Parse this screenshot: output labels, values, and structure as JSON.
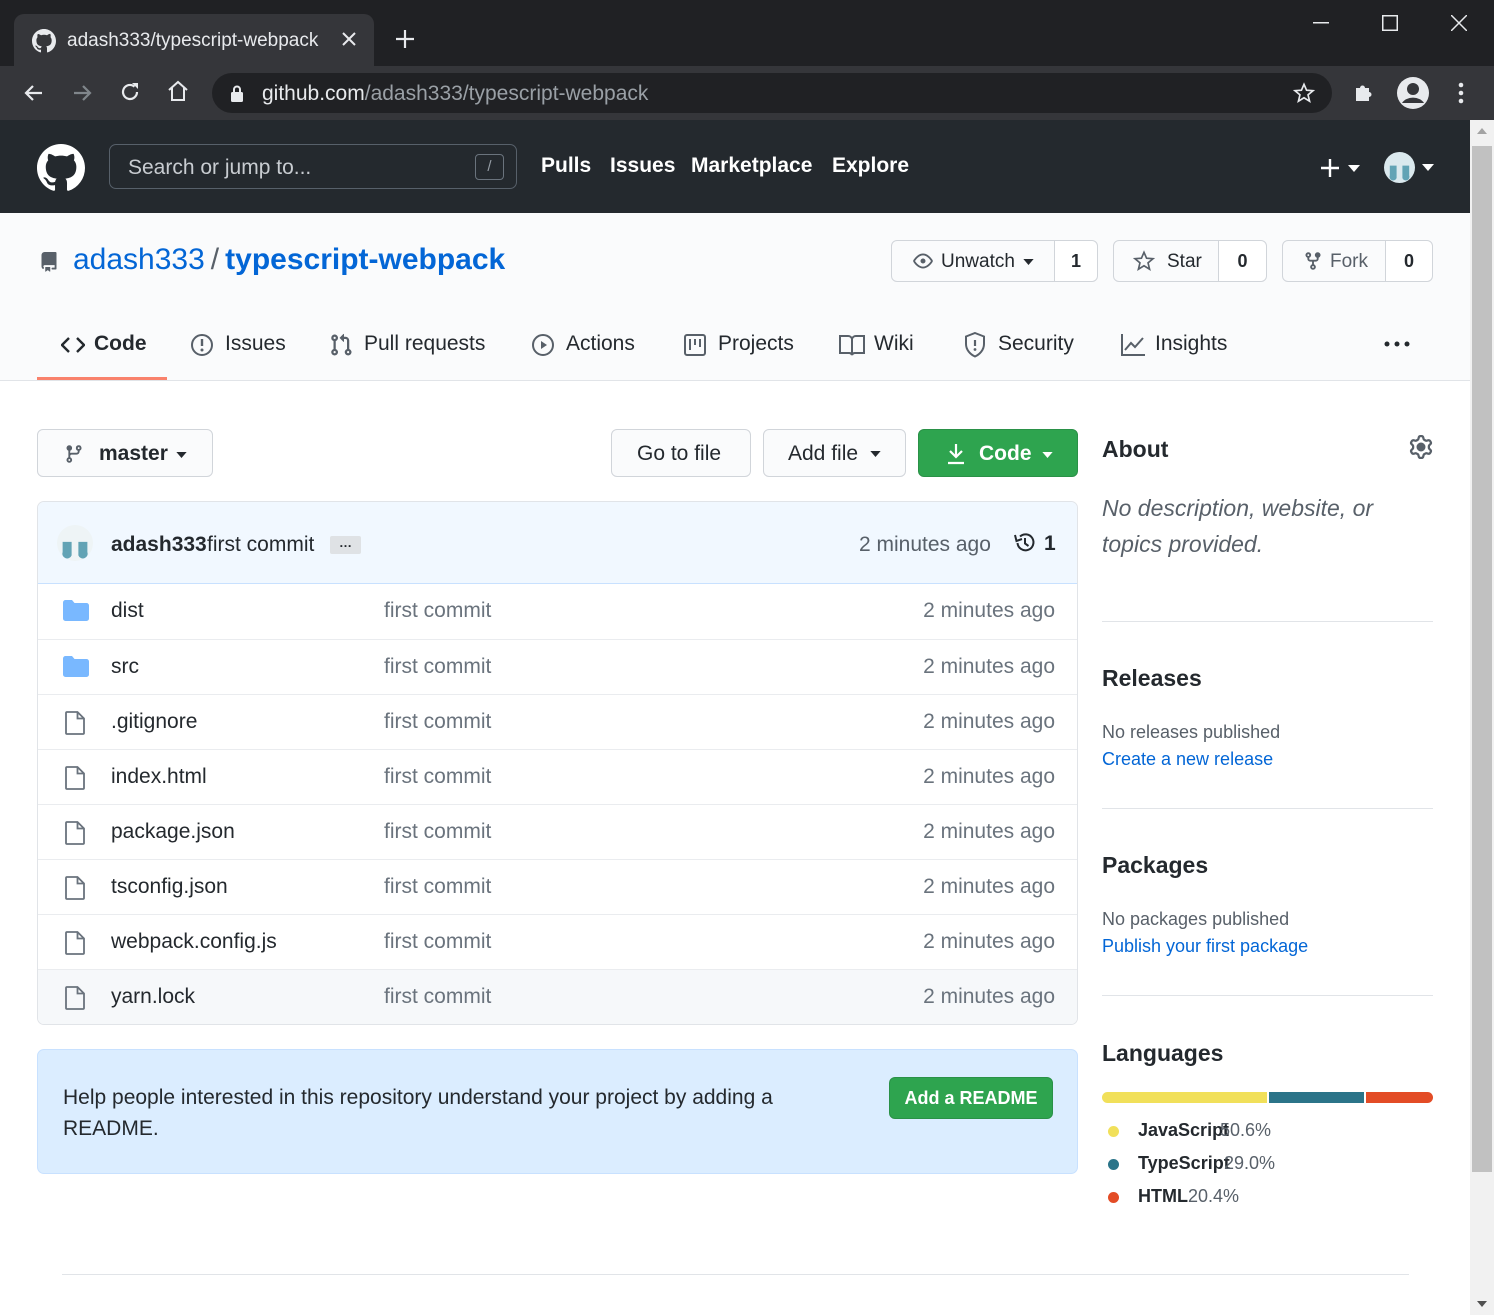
{
  "browser": {
    "tab_title": "adash333/typescript-webpack",
    "url_host": "github.com",
    "url_path": "/adash333/typescript-webpack"
  },
  "header": {
    "search_placeholder": "Search or jump to...",
    "search_shortcut": "/",
    "nav": [
      "Pulls",
      "Issues",
      "Marketplace",
      "Explore"
    ]
  },
  "repo": {
    "owner": "adash333",
    "separator": "/",
    "name": "typescript-webpack",
    "unwatch_label": "Unwatch",
    "watch_count": "1",
    "star_label": "Star",
    "star_count": "0",
    "fork_label": "Fork",
    "fork_count": "0"
  },
  "tabs": [
    "Code",
    "Issues",
    "Pull requests",
    "Actions",
    "Projects",
    "Wiki",
    "Security",
    "Insights"
  ],
  "toolbar": {
    "branch": "master",
    "go_to_file": "Go to file",
    "add_file": "Add file",
    "code": "Code"
  },
  "commit": {
    "author": "adash333",
    "message": "first commit",
    "ellipsis": "…",
    "age": "2 minutes ago",
    "count": "1"
  },
  "files": [
    {
      "name": "dist",
      "type": "dir",
      "message": "first commit",
      "age": "2 minutes ago"
    },
    {
      "name": "src",
      "type": "dir",
      "message": "first commit",
      "age": "2 minutes ago"
    },
    {
      "name": ".gitignore",
      "type": "file",
      "message": "first commit",
      "age": "2 minutes ago"
    },
    {
      "name": "index.html",
      "type": "file",
      "message": "first commit",
      "age": "2 minutes ago"
    },
    {
      "name": "package.json",
      "type": "file",
      "message": "first commit",
      "age": "2 minutes ago"
    },
    {
      "name": "tsconfig.json",
      "type": "file",
      "message": "first commit",
      "age": "2 minutes ago"
    },
    {
      "name": "webpack.config.js",
      "type": "file",
      "message": "first commit",
      "age": "2 minutes ago"
    },
    {
      "name": "yarn.lock",
      "type": "file",
      "message": "first commit",
      "age": "2 minutes ago"
    }
  ],
  "readme": {
    "text": "Help people interested in this repository understand your project by adding a README.",
    "button": "Add a README"
  },
  "sidebar": {
    "about_title": "About",
    "about_desc": "No description, website, or topics provided.",
    "releases_title": "Releases",
    "releases_none": "No releases published",
    "releases_link": "Create a new release",
    "packages_title": "Packages",
    "packages_none": "No packages published",
    "packages_link": "Publish your first package",
    "languages_title": "Languages",
    "languages": [
      {
        "name": "JavaScript",
        "percent": "50.6%",
        "value": 50.6,
        "color": "#f1e05a"
      },
      {
        "name": "TypeScript",
        "percent": "29.0%",
        "value": 29.0,
        "color": "#2b7489"
      },
      {
        "name": "HTML",
        "percent": "20.4%",
        "value": 20.4,
        "color": "#e34c26"
      }
    ]
  },
  "colors": {
    "link": "#0366d6",
    "primary_button": "#2ea44f",
    "tab_underline": "#f9826c"
  }
}
